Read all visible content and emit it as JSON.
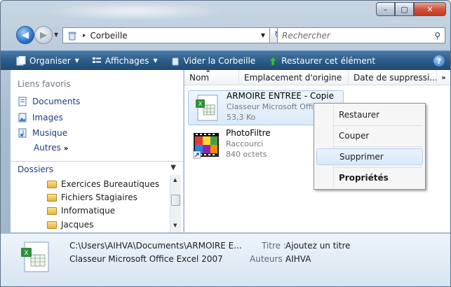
{
  "window": {
    "title": "Corbeille"
  },
  "window_controls": {
    "minimize": "–",
    "maximize": "▢",
    "close": "✕"
  },
  "address": {
    "crumb": "Corbeille",
    "separator": "▸"
  },
  "search": {
    "placeholder": "Rechercher"
  },
  "toolbar": {
    "organize": "Organiser",
    "views": "Affichages",
    "empty_bin": "Vider la Corbeille",
    "restore": "Restaurer cet élément",
    "help": "?"
  },
  "nav": {
    "favorites_header": "Liens favoris",
    "favorites": [
      "Documents",
      "Images",
      "Musique"
    ],
    "more": "Autres",
    "more_arrow": "»",
    "folders_header": "Dossiers",
    "folders": [
      "Exercices Bureautiques",
      "Fichiers Stagiaires",
      "Informatique",
      "Jacques"
    ]
  },
  "columns": {
    "name": "Nom",
    "origin": "Emplacement d'origine",
    "date": "Date de suppressi...",
    "more": "»"
  },
  "files": [
    {
      "name": "ARMOIRE ENTREE - Copie",
      "type": "Classeur Microsoft Offic",
      "size": "53,3 Ko"
    },
    {
      "name": "PhotoFiltre",
      "type": "Raccourci",
      "size": "840 octets"
    }
  ],
  "context_menu": {
    "restore": "Restaurer",
    "cut": "Couper",
    "delete": "Supprimer",
    "properties": "Propriétés"
  },
  "details": {
    "path": "C:\\Users\\AIHVA\\Documents\\ARMOIRE E...",
    "type": "Classeur Microsoft Office Excel 2007",
    "title_label": "Titre :",
    "title_value": "Ajoutez un titre",
    "authors_label": "Auteurs :",
    "authors_value": "AIHVA"
  },
  "colors": {
    "toolbar": "#2f5f8c",
    "selection": "#dbeaf9",
    "link": "#1e3e7a"
  }
}
